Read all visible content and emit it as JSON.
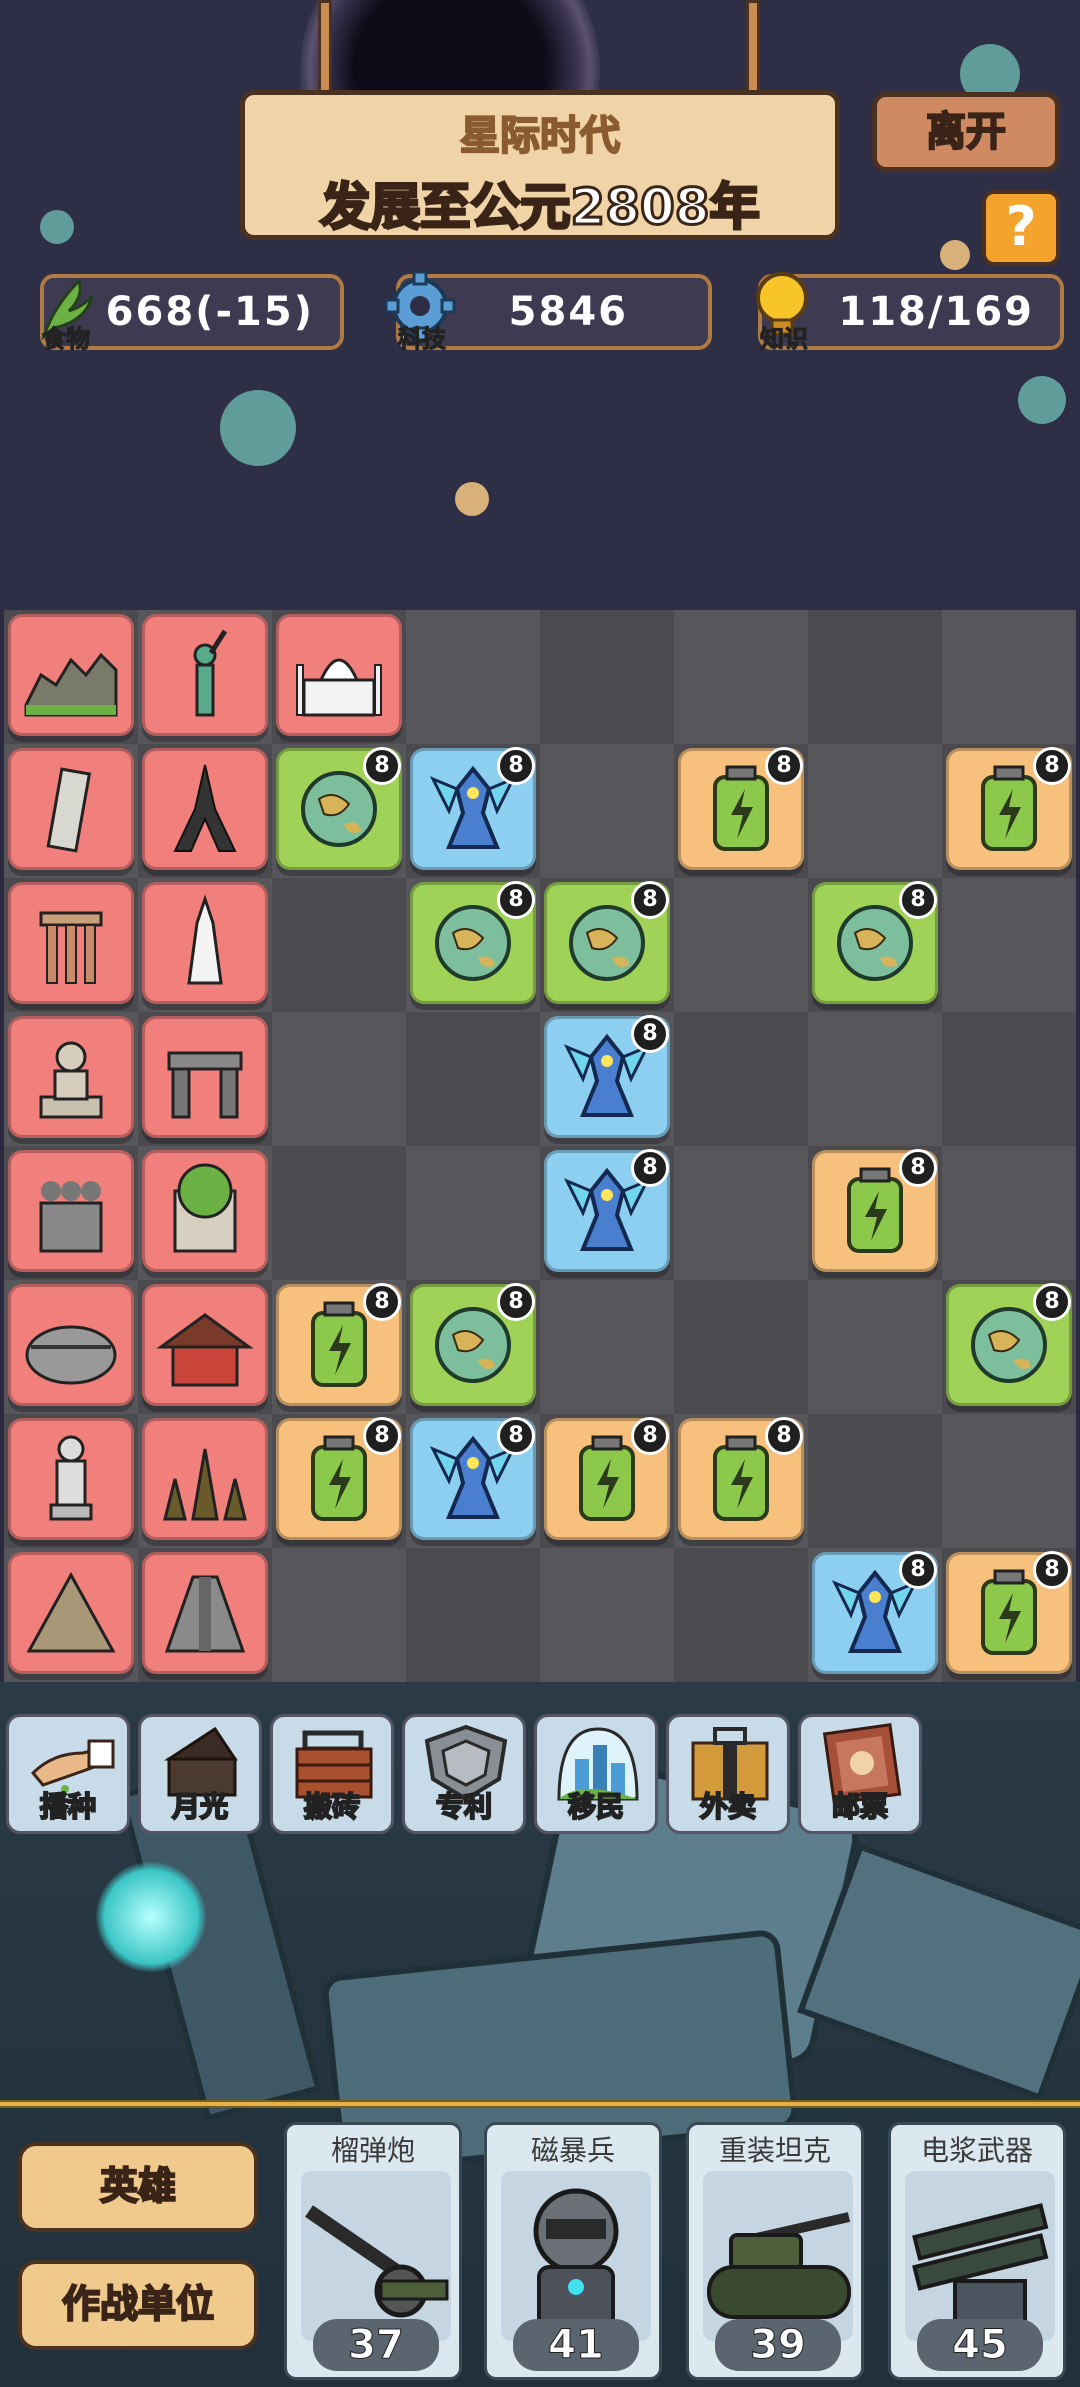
{
  "header": {
    "era": "星际时代",
    "year_text": "发展至公元2808年",
    "leave_label": "离开",
    "help_label": "?"
  },
  "resources": [
    {
      "label": "食物",
      "value": "668(-15)",
      "icon": "leaf-icon"
    },
    {
      "label": "科技",
      "value": "5846",
      "icon": "gear-icon"
    },
    {
      "label": "知识",
      "value": "118/169",
      "icon": "bulb-icon"
    }
  ],
  "board": {
    "level_badge": "8",
    "wonders_col1": [
      "great-wall",
      "leaning-tower-pisa",
      "temple-ruin",
      "zeus-statue",
      "terracotta-warriors",
      "colosseum",
      "david-statue",
      "pyramid"
    ],
    "wonders_col2": [
      "statue-of-liberty",
      "eiffel-tower",
      "tower-lighthouse",
      "stonehenge",
      "hanging-gardens",
      "forbidden-city",
      "angkor-wat",
      "mayan-pyramid"
    ],
    "wonder_row1_col3": "taj-mahal",
    "units": [
      {
        "row": 2,
        "col": 3,
        "type": "planet"
      },
      {
        "row": 2,
        "col": 4,
        "type": "mech"
      },
      {
        "row": 2,
        "col": 6,
        "type": "battery"
      },
      {
        "row": 2,
        "col": 8,
        "type": "battery"
      },
      {
        "row": 3,
        "col": 4,
        "type": "planet"
      },
      {
        "row": 3,
        "col": 5,
        "type": "planet"
      },
      {
        "row": 3,
        "col": 7,
        "type": "planet"
      },
      {
        "row": 4,
        "col": 5,
        "type": "mech"
      },
      {
        "row": 5,
        "col": 5,
        "type": "mech"
      },
      {
        "row": 5,
        "col": 7,
        "type": "battery"
      },
      {
        "row": 6,
        "col": 3,
        "type": "battery"
      },
      {
        "row": 6,
        "col": 4,
        "type": "planet"
      },
      {
        "row": 6,
        "col": 8,
        "type": "planet"
      },
      {
        "row": 7,
        "col": 3,
        "type": "battery"
      },
      {
        "row": 7,
        "col": 4,
        "type": "mech"
      },
      {
        "row": 7,
        "col": 5,
        "type": "battery"
      },
      {
        "row": 7,
        "col": 6,
        "type": "battery"
      },
      {
        "row": 8,
        "col": 7,
        "type": "mech"
      },
      {
        "row": 8,
        "col": 8,
        "type": "battery"
      }
    ]
  },
  "tools": [
    {
      "label": "播种",
      "icon": "sowing-hand-icon"
    },
    {
      "label": "月光",
      "icon": "moonlight-box-icon"
    },
    {
      "label": "搬砖",
      "icon": "bricks-icon"
    },
    {
      "label": "专利",
      "icon": "patent-shield-icon"
    },
    {
      "label": "移民",
      "icon": "city-dome-icon"
    },
    {
      "label": "外卖",
      "icon": "delivery-box-icon"
    },
    {
      "label": "邮票",
      "icon": "stamp-icon"
    }
  ],
  "side_buttons": {
    "hero": "英雄",
    "combat_units": "作战单位"
  },
  "units": [
    {
      "name": "榴弹炮",
      "cost": "37",
      "icon": "howitzer-icon"
    },
    {
      "name": "磁暴兵",
      "cost": "41",
      "icon": "tesla-trooper-icon"
    },
    {
      "name": "重装坦克",
      "cost": "39",
      "icon": "heavy-tank-icon"
    },
    {
      "name": "电浆武器",
      "cost": "45",
      "icon": "plasma-cannon-icon"
    }
  ]
}
